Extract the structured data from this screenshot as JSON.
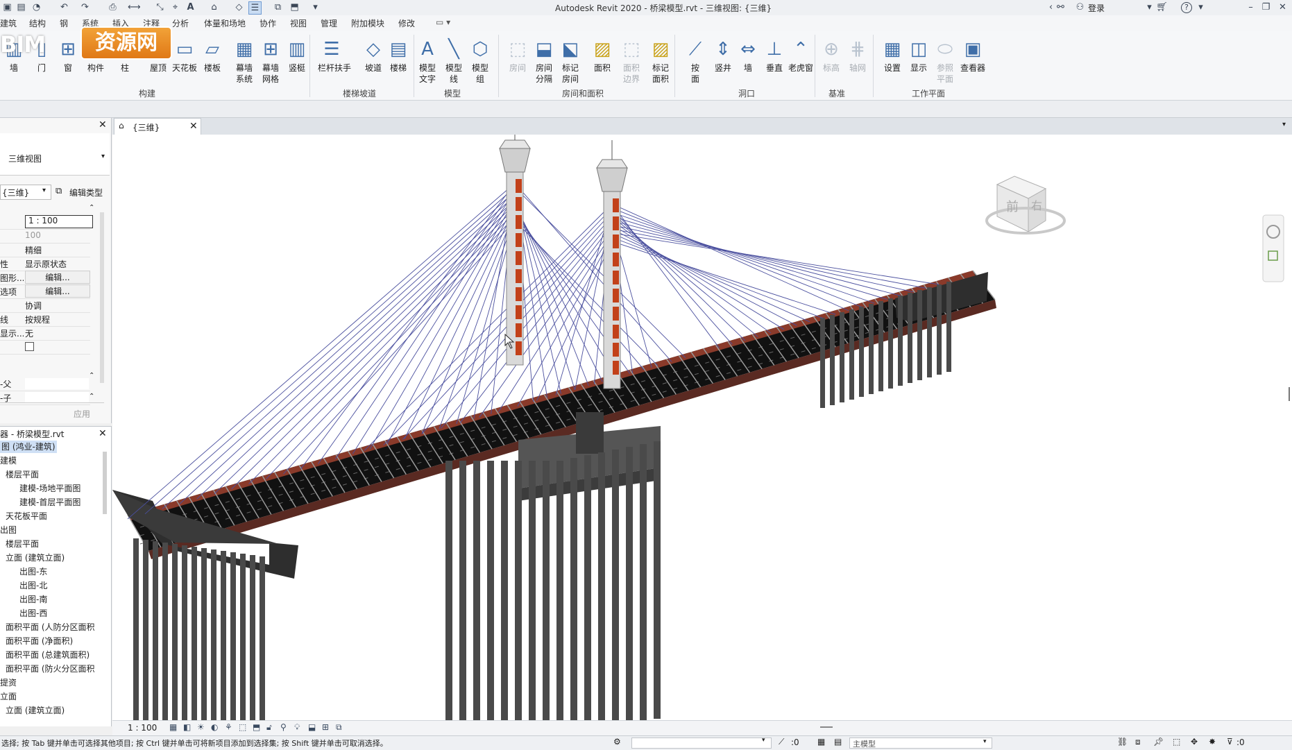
{
  "window": {
    "title": "Autodesk Revit 2020 - 桥梁模型.rvt - 三维视图: {三维}",
    "login": "登录"
  },
  "menu": [
    "建筑",
    "结构",
    "钢",
    "系统",
    "插入",
    "注释",
    "分析",
    "体量和场地",
    "协作",
    "视图",
    "管理",
    "附加模块",
    "修改"
  ],
  "ribbon": {
    "tools": [
      {
        "label": "墙",
        "icon": "wall-icon"
      },
      {
        "label": "门",
        "icon": "door-icon"
      },
      {
        "label": "窗",
        "icon": "window-icon"
      },
      {
        "label": "构件",
        "icon": "component-icon"
      },
      {
        "label": "柱",
        "icon": "column-icon"
      },
      {
        "label": "屋顶",
        "icon": "roof-icon"
      },
      {
        "label": "天花板",
        "icon": "ceiling-icon"
      },
      {
        "label": "楼板",
        "icon": "floor-icon"
      },
      {
        "label": "幕墙\n系统",
        "icon": "curtain-system-icon"
      },
      {
        "label": "幕墙\n网格",
        "icon": "curtain-grid-icon"
      },
      {
        "label": "竖梃",
        "icon": "mullion-icon"
      },
      {
        "label": "栏杆扶手",
        "icon": "railing-icon"
      },
      {
        "label": "坡道",
        "icon": "ramp-icon"
      },
      {
        "label": "楼梯",
        "icon": "stair-icon"
      },
      {
        "label": "模型\n文字",
        "icon": "model-text-icon"
      },
      {
        "label": "模型\n线",
        "icon": "model-line-icon"
      },
      {
        "label": "模型\n组",
        "icon": "model-group-icon"
      },
      {
        "label": "房间",
        "icon": "room-icon"
      },
      {
        "label": "房间\n分隔",
        "icon": "room-separator-icon"
      },
      {
        "label": "标记\n房间",
        "icon": "tag-room-icon"
      },
      {
        "label": "面积",
        "icon": "area-icon"
      },
      {
        "label": "面积\n边界",
        "icon": "area-boundary-icon"
      },
      {
        "label": "标记\n面积",
        "icon": "tag-area-icon"
      },
      {
        "label": "按\n面",
        "icon": "by-face-icon"
      },
      {
        "label": "竖井",
        "icon": "shaft-icon"
      },
      {
        "label": "墙",
        "icon": "wall-opening-icon"
      },
      {
        "label": "垂直",
        "icon": "vertical-opening-icon"
      },
      {
        "label": "老虎窗",
        "icon": "dormer-icon"
      },
      {
        "label": "标高",
        "icon": "level-icon"
      },
      {
        "label": "轴网",
        "icon": "grid-icon"
      },
      {
        "label": "设置",
        "icon": "set-plane-icon"
      },
      {
        "label": "显示",
        "icon": "show-plane-icon"
      },
      {
        "label": "参照\n平面",
        "icon": "ref-plane-icon"
      },
      {
        "label": "查看器",
        "icon": "viewer-icon"
      }
    ],
    "groups": [
      "构建",
      "楼梯坡道",
      "模型",
      "房间和面积",
      "洞口",
      "基准",
      "工作平面"
    ]
  },
  "logo": {
    "brand": "BIM",
    "site": "资源网"
  },
  "properties": {
    "type_name": "三维视图",
    "selector": "{三维}",
    "edit_type": "编辑类型",
    "rows": [
      {
        "k": "",
        "v": "1 : 100"
      },
      {
        "k": "",
        "v": "100"
      },
      {
        "k": "",
        "v": "精细"
      },
      {
        "k": "性",
        "v": "显示原状态"
      },
      {
        "k": "图形...",
        "v": "编辑..."
      },
      {
        "k": "选项",
        "v": "编辑..."
      },
      {
        "k": "",
        "v": "协调"
      },
      {
        "k": "线",
        "v": "按规程"
      },
      {
        "k": "显示...",
        "v": "无"
      },
      {
        "k": "",
        "v": ""
      }
    ],
    "rows2": [
      {
        "k": "-父",
        "v": ""
      },
      {
        "k": "-子",
        "v": ""
      }
    ],
    "apply": "应用"
  },
  "browser": {
    "title": "器 - 桥梁模型.rvt",
    "nodes": [
      {
        "t": "图 (鸿业-建筑)",
        "lvl": 0,
        "sel": true
      },
      {
        "t": "建模",
        "lvl": 0
      },
      {
        "t": "楼层平面",
        "lvl": 1
      },
      {
        "t": "建模-场地平面图",
        "lvl": 2
      },
      {
        "t": "建模-首层平面图",
        "lvl": 2
      },
      {
        "t": "天花板平面",
        "lvl": 1
      },
      {
        "t": "出图",
        "lvl": 0
      },
      {
        "t": "楼层平面",
        "lvl": 1
      },
      {
        "t": "立面 (建筑立面)",
        "lvl": 1
      },
      {
        "t": "出图-东",
        "lvl": 2
      },
      {
        "t": "出图-北",
        "lvl": 2
      },
      {
        "t": "出图-南",
        "lvl": 2
      },
      {
        "t": "出图-西",
        "lvl": 2
      },
      {
        "t": "面积平面 (人防分区面积",
        "lvl": 1
      },
      {
        "t": "面积平面 (净面积)",
        "lvl": 1
      },
      {
        "t": "面积平面 (总建筑面积)",
        "lvl": 1
      },
      {
        "t": "面积平面 (防火分区面积",
        "lvl": 1
      },
      {
        "t": "提资",
        "lvl": 0
      },
      {
        "t": "立面",
        "lvl": 0
      },
      {
        "t": "立面 (建筑立面)",
        "lvl": 1
      }
    ]
  },
  "view": {
    "tab": "{三维}",
    "scale": "1 : 100",
    "cube_front": "前",
    "cube_right": "右"
  },
  "status": {
    "hint": "选择; 按 Tab 键并单击可选择其他项目; 按 Ctrl 键并单击可将新项目添加到选择集; 按 Shift 键并单击可取消选择。",
    "zero1": ":0",
    "model": "主模型",
    "zero2": ":0"
  },
  "colors": {
    "accent": "#1c5fb8",
    "logo": "#e8861f",
    "deck": "#111111",
    "tower": "#d9d9d9",
    "tower_deco": "#c2411a",
    "cables": "#4a4f9e",
    "pier": "#4a4a4a"
  }
}
